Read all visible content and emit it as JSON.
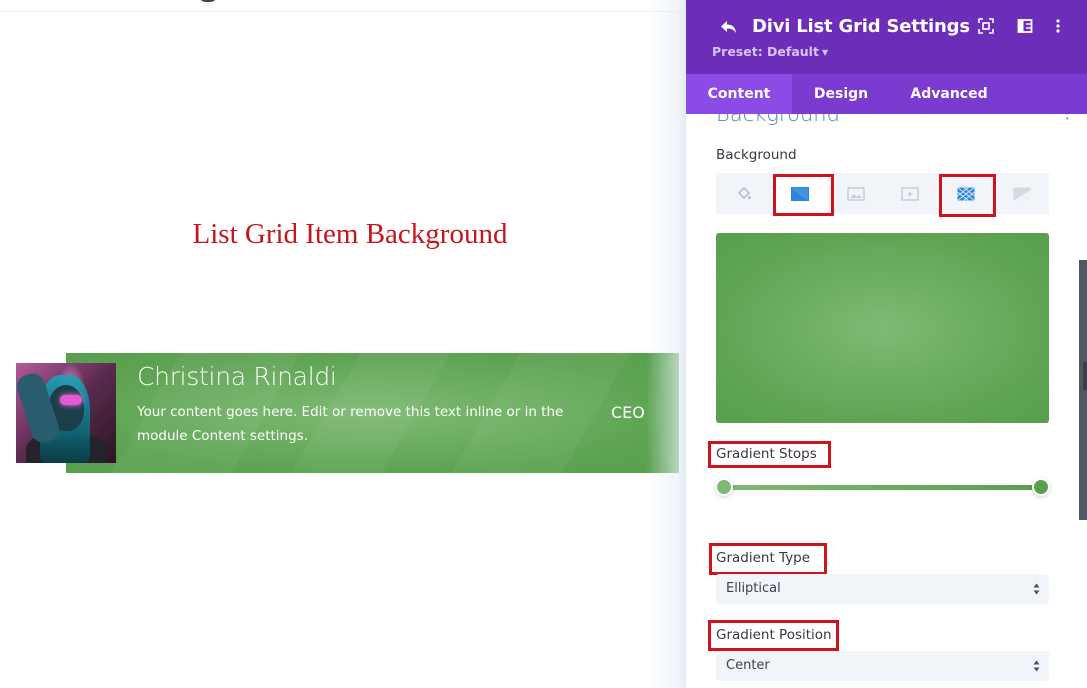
{
  "canvas": {
    "heading": "List Grid Item Background",
    "list_item": {
      "name": "Christina Rinaldi",
      "description": "Your content goes here. Edit or remove this text inline or in the module Content settings.",
      "role": "CEO",
      "avatar_icon": "person-photo"
    },
    "highlight_color": "#d0121b"
  },
  "panel": {
    "title": "Divi List Grid Settings",
    "preset_label": "Preset: Default",
    "header_icons": [
      "back-icon",
      "focus-icon",
      "sidebar-layout-icon",
      "more-vertical-icon"
    ],
    "header_color": "#6c2eb9",
    "tabs": [
      {
        "label": "Content",
        "active": true
      },
      {
        "label": "Design",
        "active": false
      },
      {
        "label": "Advanced",
        "active": false
      }
    ],
    "section_title": "Background",
    "background": {
      "label": "Background",
      "types": [
        {
          "name": "color",
          "icon": "paint-bucket-icon",
          "active": false,
          "highlighted": false
        },
        {
          "name": "gradient",
          "icon": "gradient-icon",
          "active": true,
          "highlighted": true
        },
        {
          "name": "image",
          "icon": "image-icon",
          "active": false,
          "highlighted": false
        },
        {
          "name": "video",
          "icon": "video-icon",
          "active": false,
          "highlighted": false
        },
        {
          "name": "pattern",
          "icon": "pattern-icon",
          "active": false,
          "highlighted": true
        },
        {
          "name": "mask",
          "icon": "mask-icon",
          "active": false,
          "highlighted": false
        }
      ],
      "gradient": {
        "start_color": "#7fba74",
        "end_color": "#589f4d",
        "stops_label": "Gradient Stops",
        "stops": [
          {
            "color": "#7fba74",
            "position_percent": 0
          },
          {
            "color": "#589f4d",
            "position_percent": 100
          }
        ],
        "type_label": "Gradient Type",
        "type_value": "Elliptical",
        "position_label": "Gradient Position",
        "position_value": "Center"
      }
    }
  }
}
